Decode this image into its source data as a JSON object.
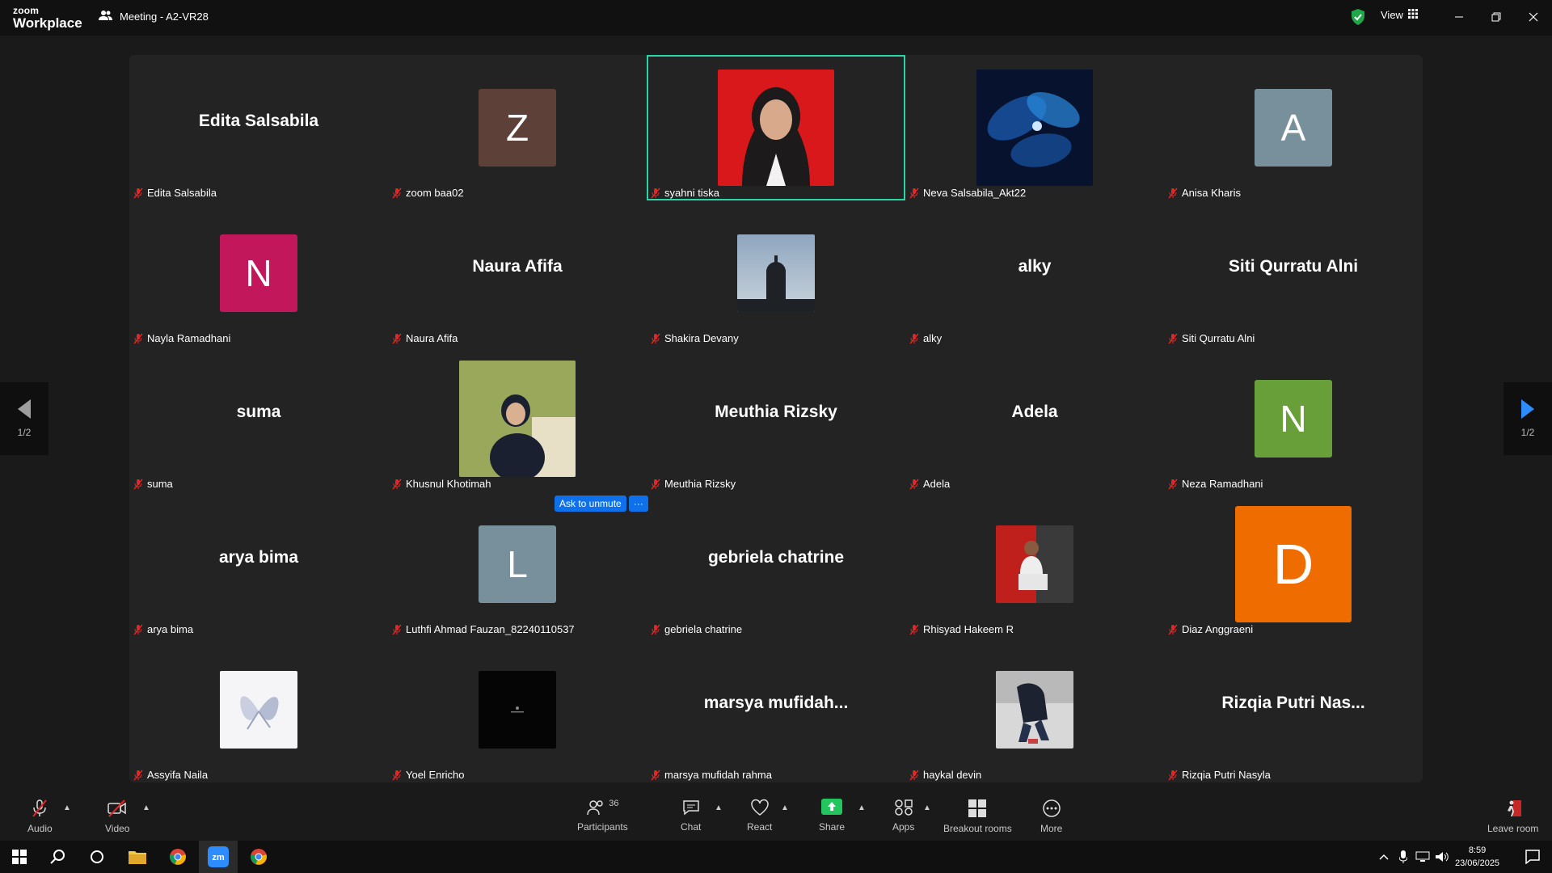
{
  "app": {
    "logo_top": "zoom",
    "logo_bottom": "Workplace",
    "meeting_title": "Meeting - A2-VR28",
    "view_label": "View"
  },
  "participants": [
    {
      "name": "Edita Salsabila",
      "display": "Edita Salsabila",
      "kind": "name"
    },
    {
      "name": "zoom baa02",
      "display": "Z",
      "kind": "avatar",
      "color": "#5d4037"
    },
    {
      "name": "syahni tiska",
      "display": "",
      "kind": "photo",
      "active": true
    },
    {
      "name": "Neva Salsabila_Akt22",
      "display": "",
      "kind": "photo"
    },
    {
      "name": "Anisa Kharis",
      "display": "A",
      "kind": "avatar",
      "color": "#78909c"
    },
    {
      "name": "Nayla Ramadhani",
      "display": "N",
      "kind": "avatar",
      "color": "#c2185b"
    },
    {
      "name": "Naura Afifa",
      "display": "Naura Afifa",
      "kind": "name"
    },
    {
      "name": "Shakira Devany",
      "display": "",
      "kind": "photo"
    },
    {
      "name": "alky",
      "display": "alky",
      "kind": "name"
    },
    {
      "name": "Siti Qurratu Alni",
      "display": "Siti Qurratu Alni",
      "kind": "name"
    },
    {
      "name": "suma",
      "display": "suma",
      "kind": "name"
    },
    {
      "name": "Khusnul Khotimah",
      "display": "",
      "kind": "photo"
    },
    {
      "name": "Meuthia Rizsky",
      "display": "Meuthia Rizsky",
      "kind": "name"
    },
    {
      "name": "Adela",
      "display": "Adela",
      "kind": "name"
    },
    {
      "name": "Neza Ramadhani",
      "display": "N",
      "kind": "avatar",
      "color": "#689f38"
    },
    {
      "name": "arya bima",
      "display": "arya bima",
      "kind": "name"
    },
    {
      "name": "Luthfi Ahmad Fauzan_82240110537",
      "display": "L",
      "kind": "avatar",
      "color": "#78909c"
    },
    {
      "name": "gebriela chatrine",
      "display": "gebriela chatrine",
      "kind": "name"
    },
    {
      "name": "Rhisyad Hakeem R",
      "display": "",
      "kind": "photo"
    },
    {
      "name": "Diaz Anggraeni",
      "display": "D",
      "kind": "avatar-big",
      "color": "#ef6c00"
    },
    {
      "name": "Assyifa Naila",
      "display": "",
      "kind": "photo"
    },
    {
      "name": "Yoel Enricho",
      "display": "",
      "kind": "photo"
    },
    {
      "name": "marsya mufidah rahma",
      "display": "marsya  mufidah...",
      "kind": "name"
    },
    {
      "name": "haykal devin",
      "display": "",
      "kind": "photo"
    },
    {
      "name": "Rizqia Putri Nasyla",
      "display": "Rizqia Putri Nas...",
      "kind": "name"
    }
  ],
  "ask_unmute": {
    "label": "Ask to unmute",
    "more": "···"
  },
  "pagination": {
    "left": "1/2",
    "right": "1/2"
  },
  "toolbar": {
    "audio": "Audio",
    "video": "Video",
    "participants": "Participants",
    "participants_count": "36",
    "chat": "Chat",
    "react": "React",
    "share": "Share",
    "apps": "Apps",
    "breakout": "Breakout rooms",
    "more": "More",
    "leave": "Leave room"
  },
  "clock": {
    "time": "8:59",
    "date": "23/06/2025"
  }
}
